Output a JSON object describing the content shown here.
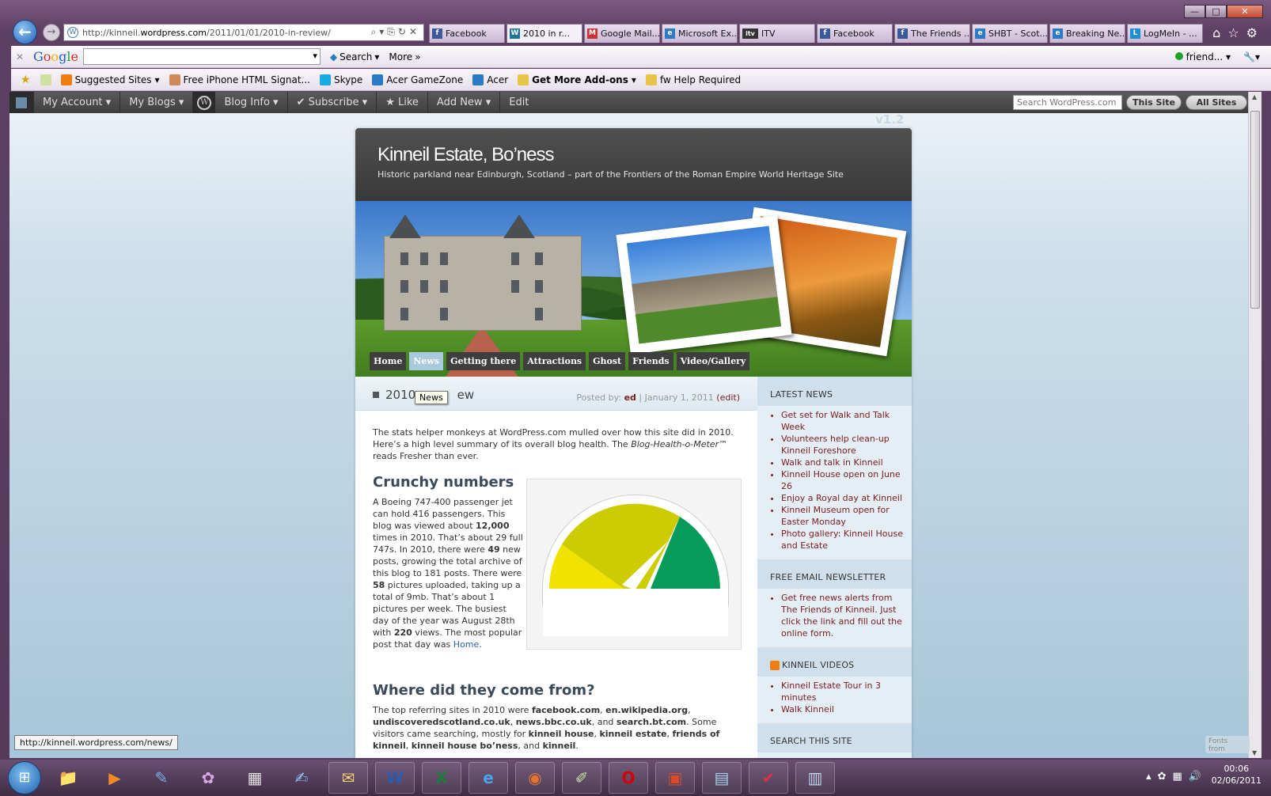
{
  "browser": {
    "url_prefix": "http://kinneil.",
    "url_domain": "wordpress.com",
    "url_path": "/2011/01/01/2010-in-review/",
    "tabs": [
      {
        "label": "Facebook",
        "icon": "facebook-icon",
        "color": "#3b5998",
        "glyph": "f"
      },
      {
        "label": "2010 in r...",
        "icon": "wordpress-icon",
        "color": "#21759b",
        "glyph": "W",
        "active": true
      },
      {
        "label": "Google Mail...",
        "icon": "gmail-icon",
        "color": "#c33",
        "glyph": "M"
      },
      {
        "label": "Microsoft Ex...",
        "icon": "ie-icon",
        "color": "#2a7ac6",
        "glyph": "e"
      },
      {
        "label": "ITV",
        "icon": "itv-icon",
        "color": "#333",
        "glyph": "itv"
      },
      {
        "label": "Facebook",
        "icon": "facebook-icon",
        "color": "#3b5998",
        "glyph": "f"
      },
      {
        "label": "The Friends ...",
        "icon": "facebook-icon",
        "color": "#3b5998",
        "glyph": "f"
      },
      {
        "label": "SHBT - Scot...",
        "icon": "ie-icon",
        "color": "#2a7ac6",
        "glyph": "e"
      },
      {
        "label": "Breaking Ne...",
        "icon": "ie-icon",
        "color": "#2a7ac6",
        "glyph": "e"
      },
      {
        "label": "LogMeIn - ...",
        "icon": "logmein-icon",
        "color": "#1d8fd2",
        "glyph": "L"
      }
    ],
    "google_bar": {
      "logo": "Google",
      "search_label": "Search",
      "more_label": "More",
      "profile_label": "friend..."
    },
    "favorites": [
      {
        "label": "Suggested Sites",
        "color": "#f07d12",
        "dropdown": true
      },
      {
        "label": "Free iPhone HTML Signat...",
        "color": "#d08a5a"
      },
      {
        "label": "Skype",
        "color": "#1ba9e6"
      },
      {
        "label": "Acer GameZone",
        "color": "#2a7ac6"
      },
      {
        "label": "Acer",
        "color": "#2a7ac6"
      },
      {
        "label": "Get More Add-ons",
        "color": "#e8c44a",
        "dropdown": true,
        "bold": true
      },
      {
        "label": "fw Help Required",
        "color": "#e8c44a"
      }
    ],
    "status_url": "http://kinneil.wordpress.com/news/"
  },
  "wp_admin_bar": {
    "items": [
      "My Account",
      "My Blogs",
      "Blog Info",
      "Subscribe",
      "Like",
      "Add New",
      "Edit"
    ],
    "search_placeholder": "Search WordPress.com",
    "this_site": "This Site",
    "all_sites": "All Sites"
  },
  "version_text": "v1.2",
  "site": {
    "title": "Kinneil Estate, Bo’ness",
    "subtitle": "Historic parkland near Edinburgh, Scotland – part of the Frontiers of the Roman Empire World Heritage Site",
    "nav": [
      "Home",
      "News",
      "Getting there",
      "Attractions",
      "Ghost",
      "Friends",
      "Video/Gallery"
    ],
    "tooltip": "News"
  },
  "post": {
    "title_start": "2010",
    "title_end": "ew",
    "posted_by_label": "Posted by:",
    "author": "ed",
    "date": "January 1, 2011",
    "edit": "(edit)",
    "intro_1": "The stats helper monkeys at WordPress.com mulled over how this site did in 2010. Here’s a high level summary of its overall blog health.  The ",
    "intro_em": "Blog-Health-o-Meter™",
    "intro_2": " reads Fresher than ever.",
    "h_crunchy": "Crunchy numbers",
    "crunchy_1": "A Boeing 747-400 passenger jet can hold 416 passengers. This blog was viewed about ",
    "views": "12,000",
    "crunchy_2": " times in 2010. That’s about 29 full 747s. In 2010, there were ",
    "new_posts": "49",
    "crunchy_3": " new posts, growing the total archive of this blog to 181 posts. There were ",
    "pictures": "58",
    "crunchy_4": " pictures uploaded, taking up a total of 9mb. That’s about 1 pictures per week. The busiest day of the year was August 28th with ",
    "busiest_views": "220",
    "crunchy_5": " views. The most popular post that day was ",
    "popular_link": "Home",
    "crunchy_6": ".",
    "h_where": "Where did they come from?",
    "where_1": "The top referring sites in 2010 were ",
    "ref1": "facebook.com",
    "ref2": "en.wikipedia.org",
    "ref3": "undiscoveredscotland.co.uk",
    "ref4": "news.bbc.co.uk",
    "ref5": "search.bt.com",
    "where_2": ". Some visitors came searching, mostly for ",
    "term1": "kinneil house",
    "term2": "kinneil estate",
    "term3": "friends of kinneil",
    "term4": "kinneil house bo’ness",
    "term5": "kinneil",
    "comma": ", ",
    "and_txt": ", and ",
    "period": "."
  },
  "sidebar": {
    "latest_heading": "LATEST NEWS",
    "latest": [
      "Get set for Walk and Talk Week",
      "Volunteers help clean-up Kinneil Foreshore",
      "Walk and talk in Kinneil",
      "Kinneil House open on June 26",
      "Enjoy a Royal day at Kinneil",
      "Kinneil Museum open for Easter Monday",
      "Photo gallery: Kinneil House and Estate"
    ],
    "newsletter_heading": "FREE EMAIL NEWSLETTER",
    "newsletter": [
      "Get free news alerts from The Friends of Kinneil. Just click the link and fill out the online form."
    ],
    "videos_heading": "KINNEIL VIDEOS",
    "videos": [
      "Kinneil Estate Tour in 3 minutes",
      "Walk Kinneil"
    ],
    "search_heading": "SEARCH THIS SITE"
  },
  "gauge": {
    "level": "Fresher than ever",
    "colors": {
      "yellow": "#f2e200",
      "olive": "#cccc00",
      "green": "#079b5a"
    }
  },
  "fonts_badge": "Fonts from",
  "clock": {
    "time": "00:06",
    "date": "02/06/2011"
  },
  "taskbar": [
    {
      "name": "explorer-icon",
      "glyph": "📁",
      "color": "#f0c040"
    },
    {
      "name": "media-player-icon",
      "glyph": "▶",
      "color": "#f08a24"
    },
    {
      "name": "paint-icon",
      "glyph": "✎",
      "color": "#7ab0e8"
    },
    {
      "name": "gallery-icon",
      "glyph": "✿",
      "color": "#d8a8e8"
    },
    {
      "name": "calc-icon",
      "glyph": "▦",
      "color": "#e0e0e0"
    },
    {
      "name": "sign-icon",
      "glyph": "✍",
      "color": "#8cc6f0"
    },
    {
      "name": "mail-icon",
      "glyph": "✉",
      "color": "#f2d070"
    },
    {
      "name": "word-icon",
      "glyph": "W",
      "color": "#2a5caa"
    },
    {
      "name": "excel-icon",
      "glyph": "X",
      "color": "#1e7b3a"
    },
    {
      "name": "ie-icon",
      "glyph": "e",
      "color": "#4aa3ec"
    },
    {
      "name": "firefox-icon",
      "glyph": "◉",
      "color": "#e8732a"
    },
    {
      "name": "notes-icon",
      "glyph": "✐",
      "color": "#c8e0a0"
    },
    {
      "name": "opera-icon",
      "glyph": "O",
      "color": "#d40000"
    },
    {
      "name": "pdf-icon",
      "glyph": "▣",
      "color": "#d84a2a"
    },
    {
      "name": "docs-icon",
      "glyph": "▤",
      "color": "#a8d0e8"
    },
    {
      "name": "pdf2-icon",
      "glyph": "✔",
      "color": "#e03040"
    },
    {
      "name": "network-icon",
      "glyph": "▥",
      "color": "#bcd6ec"
    }
  ]
}
